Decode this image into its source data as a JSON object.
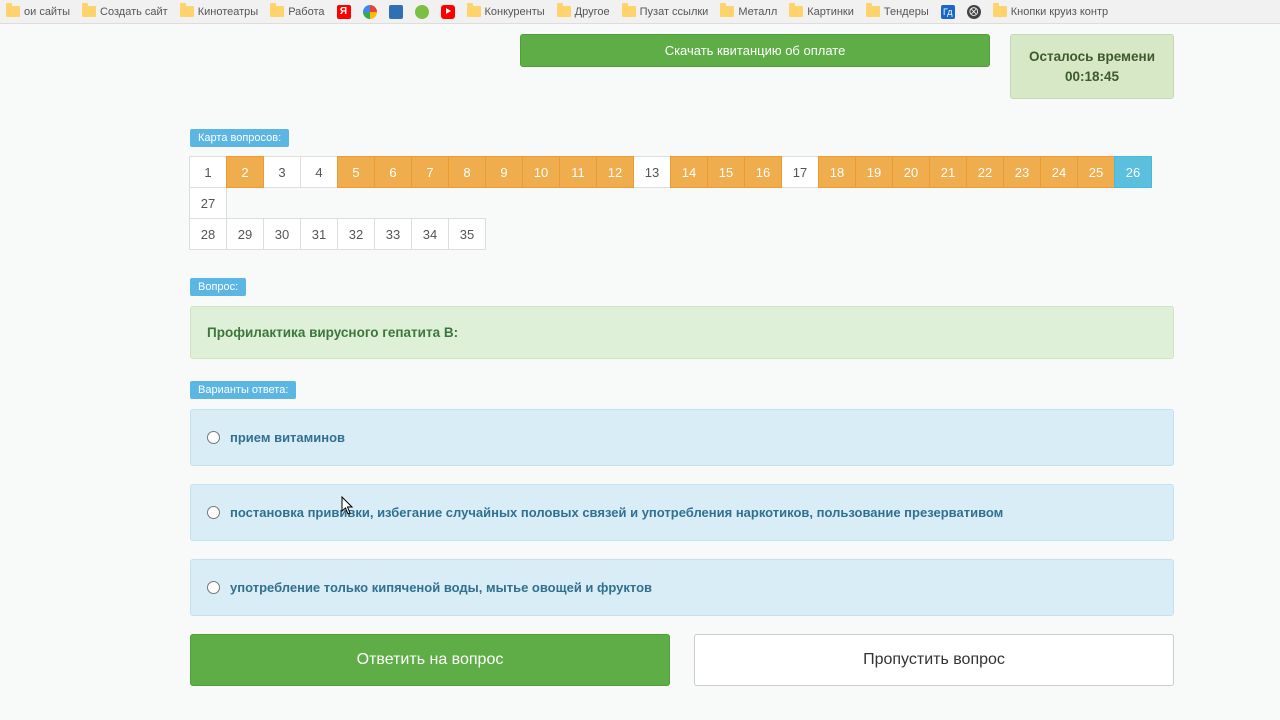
{
  "bookmarks": [
    {
      "label": "ои сайты",
      "icon": "folder"
    },
    {
      "label": "Создать сайт",
      "icon": "folder"
    },
    {
      "label": "Кинотеатры",
      "icon": "folder"
    },
    {
      "label": "Работа",
      "icon": "folder"
    },
    {
      "label": "",
      "icon": "yandex"
    },
    {
      "label": "",
      "icon": "google"
    },
    {
      "label": "",
      "icon": "fav"
    },
    {
      "label": "",
      "icon": "ok"
    },
    {
      "label": "",
      "icon": "youtube"
    },
    {
      "label": "Конкуренты",
      "icon": "folder"
    },
    {
      "label": "Другое",
      "icon": "folder"
    },
    {
      "label": "Пузат ссылки",
      "icon": "folder"
    },
    {
      "label": "Металл",
      "icon": "folder"
    },
    {
      "label": "Картинки",
      "icon": "folder"
    },
    {
      "label": "Тендеры",
      "icon": "folder"
    },
    {
      "label": "",
      "icon": "blue"
    },
    {
      "label": "",
      "icon": "dark"
    },
    {
      "label": "Кнопки круиз контр",
      "icon": "folder"
    }
  ],
  "top": {
    "download_label": "Скачать квитанцию об оплате",
    "timer_label": "Осталось времени",
    "timer_value": "00:18:45"
  },
  "labels": {
    "map": "Карта вопросов:",
    "question": "Вопрос:",
    "answers": "Варианты ответа:"
  },
  "question_map": [
    {
      "n": "1",
      "s": ""
    },
    {
      "n": "2",
      "s": "hl"
    },
    {
      "n": "3",
      "s": ""
    },
    {
      "n": "4",
      "s": ""
    },
    {
      "n": "5",
      "s": "hl"
    },
    {
      "n": "6",
      "s": "hl"
    },
    {
      "n": "7",
      "s": "hl"
    },
    {
      "n": "8",
      "s": "hl"
    },
    {
      "n": "9",
      "s": "hl"
    },
    {
      "n": "10",
      "s": "hl"
    },
    {
      "n": "11",
      "s": "hl"
    },
    {
      "n": "12",
      "s": "hl"
    },
    {
      "n": "13",
      "s": ""
    },
    {
      "n": "14",
      "s": "hl"
    },
    {
      "n": "15",
      "s": "hl"
    },
    {
      "n": "16",
      "s": "hl"
    },
    {
      "n": "17",
      "s": ""
    },
    {
      "n": "18",
      "s": "hl"
    },
    {
      "n": "19",
      "s": "hl"
    },
    {
      "n": "20",
      "s": "hl"
    },
    {
      "n": "21",
      "s": "hl"
    },
    {
      "n": "22",
      "s": "hl"
    },
    {
      "n": "23",
      "s": "hl"
    },
    {
      "n": "24",
      "s": "hl"
    },
    {
      "n": "25",
      "s": "hl"
    },
    {
      "n": "26",
      "s": "cur"
    },
    {
      "n": "27",
      "s": ""
    },
    {
      "n": "28",
      "s": ""
    },
    {
      "n": "29",
      "s": ""
    },
    {
      "n": "30",
      "s": ""
    },
    {
      "n": "31",
      "s": ""
    },
    {
      "n": "32",
      "s": ""
    },
    {
      "n": "33",
      "s": ""
    },
    {
      "n": "34",
      "s": ""
    },
    {
      "n": "35",
      "s": ""
    }
  ],
  "question_text": "Профилактика вирусного гепатита В:",
  "answers": [
    {
      "text": "прием витаминов"
    },
    {
      "text": "постановка прививки, избегание случайных половых связей и употребления наркотиков, пользование презервативом"
    },
    {
      "text": "употребление только кипяченой воды, мытье овощей и фруктов"
    }
  ],
  "buttons": {
    "answer": "Ответить на вопрос",
    "skip": "Пропустить вопрос"
  }
}
